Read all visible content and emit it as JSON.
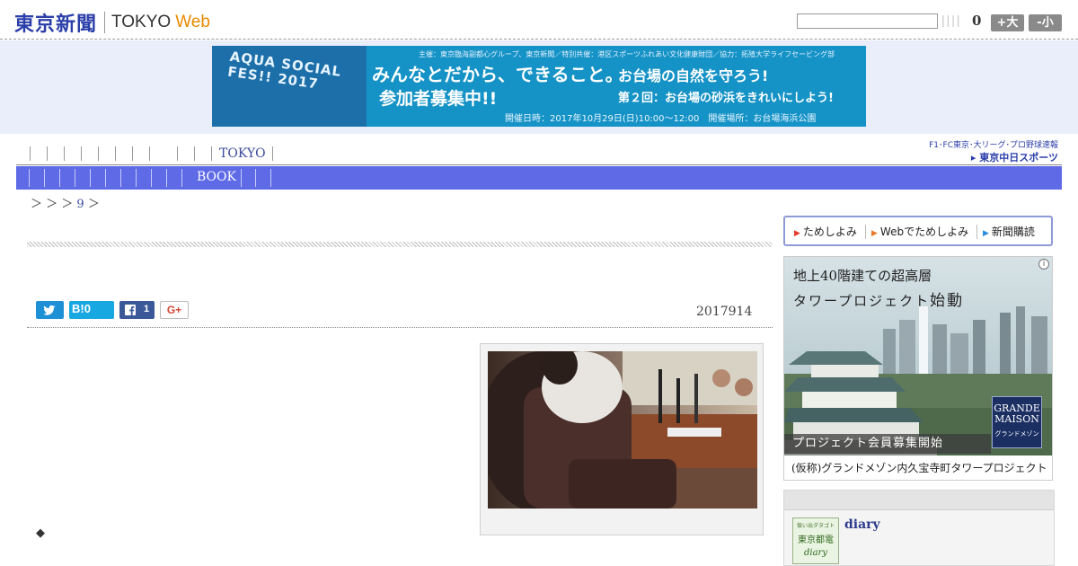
{
  "header": {
    "logo_jp": "東京新聞",
    "logo_en": "TOKYO",
    "logo_web": "Web",
    "bars": "||||",
    "count": "0",
    "font_big": "+大",
    "font_small": "-小"
  },
  "banner": {
    "shirt_text": "AQUA SOCIAL FES!! 2017",
    "sponsor": "主催：東京臨海副都心グループ、東京新聞／特別共催：港区スポーツふれあい文化健康財団／協力：拓殖大学ライフセービング部",
    "main": "みんなとだから、できること。",
    "sub": "お台場の自然を守ろう!",
    "recruit": "参加者募集中!!",
    "round": "第２回：お台場の砂浜をきれいにしよう!",
    "date": "開催日時：2017年10月29日(日)10:00〜12:00　開催場所：お台場海浜公園"
  },
  "nav": {
    "tokyo": "TOKYO",
    "book": "BOOK",
    "chunichi_top": "F1･FC東京･大リーグ･プロ野球速報",
    "chunichi_main": "▸ 東京中日スポーツ"
  },
  "breadcrumb": {
    "prefix": "＞ ＞ ＞",
    "num": "9",
    "suffix": "＞"
  },
  "article": {
    "share": {
      "twitter_count": "",
      "hatena_label": "B!0",
      "facebook_count": "1",
      "gplus": "G+"
    },
    "date": "2017914",
    "diamond": "◆"
  },
  "sidebar": {
    "trial": [
      {
        "label": "ためしよみ",
        "arrow_color": "#e23b2a"
      },
      {
        "label": "Webでためしよみ",
        "arrow_color": "#e8782a"
      },
      {
        "label": "新聞購読",
        "arrow_color": "#2a8de2"
      }
    ],
    "ad": {
      "info": "i",
      "line1": "地上40階建ての超高層",
      "line2_a": "タワープロジェクト",
      "line2_b": "始動",
      "brand_1": "GRANDE",
      "brand_2": "MAISON",
      "brand_3": "グランドメゾン",
      "bar": "プロジェクト会員募集開始",
      "foot": "(仮称)グランドメゾン内久宝寺町タワープロジェクト"
    },
    "diary": {
      "thumb_top": "懐い出ダタゴト",
      "thumb_mid": "東京都電",
      "thumb_bot": "diary",
      "title": "diary"
    }
  }
}
